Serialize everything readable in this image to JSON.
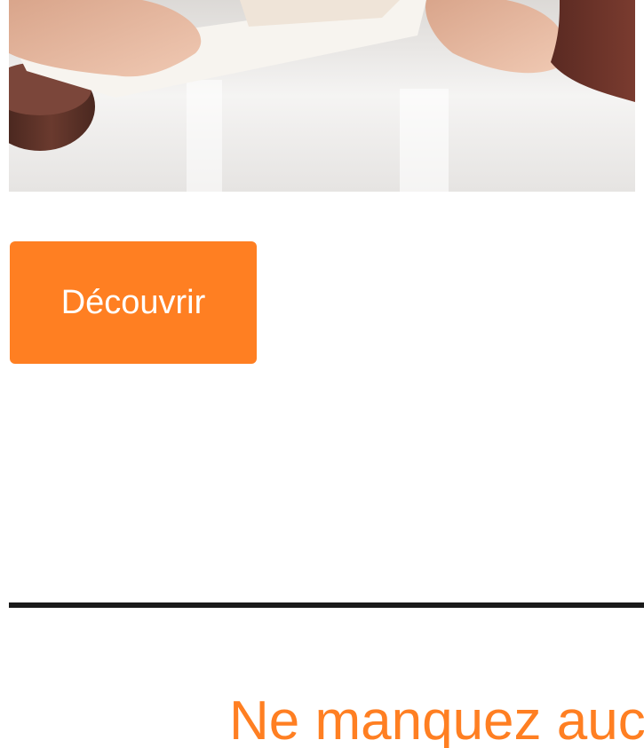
{
  "hero": {
    "image_alt": "Photo : signature de documents sur un bureau avec un marteau de juge"
  },
  "cta": {
    "label": "Découvrir"
  },
  "newsletter": {
    "title": "Ne manquez auc"
  },
  "colors": {
    "accent": "#ff7f22",
    "divider": "#1a1a1a",
    "background": "#ffffff"
  }
}
